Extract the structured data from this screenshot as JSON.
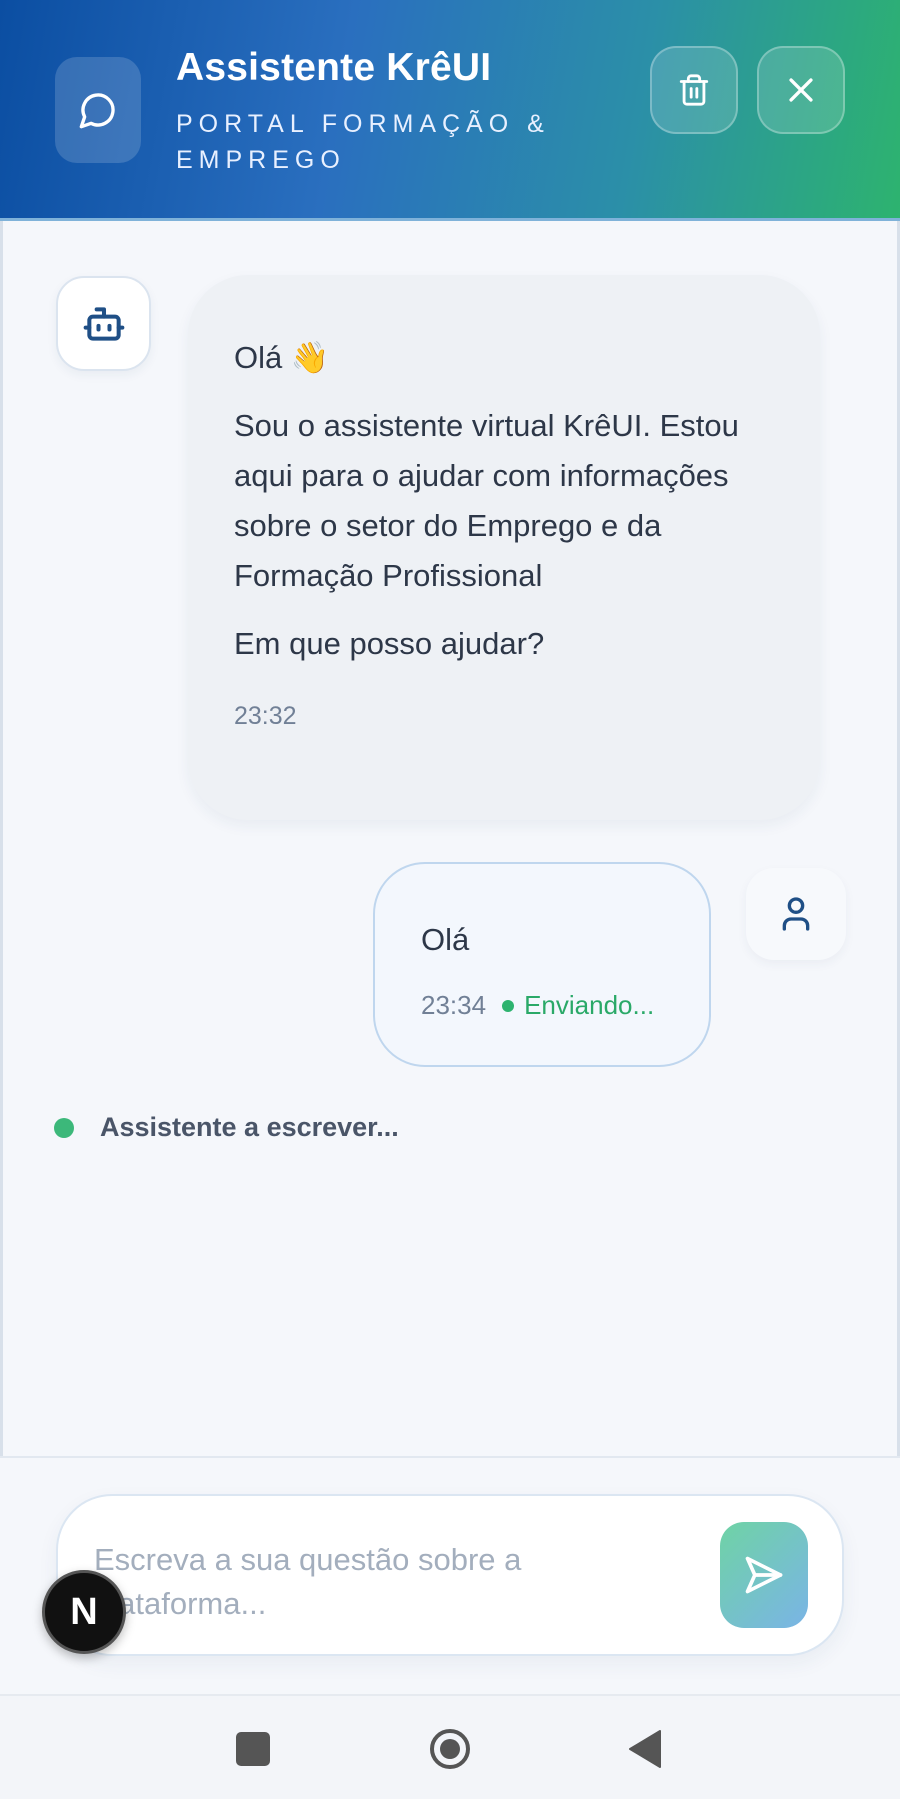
{
  "header": {
    "title": "Assistente KrêUI",
    "subtitle": "PORTAL FORMAÇÃO & EMPREGO",
    "logo_icon": "chat-bubble-icon",
    "delete_icon": "trash-icon",
    "close_icon": "close-icon"
  },
  "messages": {
    "bot": {
      "greeting": "Olá 👋",
      "intro": "Sou o assistente virtual KrêUI. Estou aqui para o ajudar com informações sobre o setor do Emprego e da Formação Profissional",
      "question": "Em que posso ajudar?",
      "time": "23:32",
      "avatar_icon": "robot-icon"
    },
    "user": {
      "text": "Olá",
      "time": "23:34",
      "status": "Enviando...",
      "avatar_icon": "user-icon"
    }
  },
  "typing_indicator": "Assistente a escrever...",
  "composer": {
    "placeholder": "Escreva a sua questão sobre a plataforma...",
    "value": "",
    "send_icon": "send-icon"
  },
  "overlay_badge": "N",
  "colors": {
    "header_gradient_start": "#0b4ea2",
    "header_gradient_end": "#2db36f",
    "accent_green": "#2db36f",
    "brand_blue": "#1f4f86"
  }
}
